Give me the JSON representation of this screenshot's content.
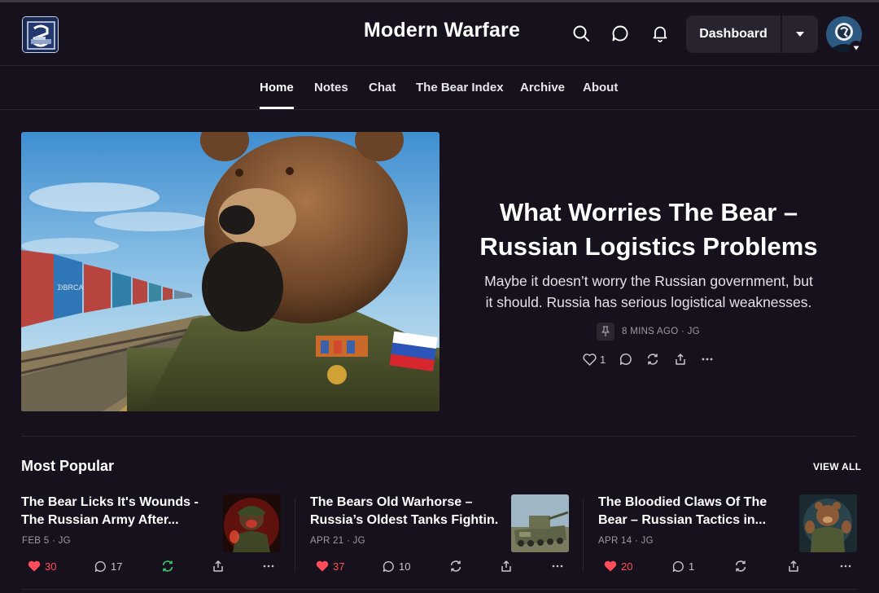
{
  "header": {
    "site_title": "Modern Warfare",
    "dashboard_label": "Dashboard",
    "icons": [
      "search-icon",
      "chat-bubble-icon",
      "bell-icon",
      "caret-down-icon"
    ]
  },
  "nav": {
    "items": [
      {
        "label": "Home",
        "active": true
      },
      {
        "label": "Notes"
      },
      {
        "label": "Chat"
      },
      {
        "label": "The Bear Index"
      },
      {
        "label": "Archive"
      },
      {
        "label": "About"
      }
    ]
  },
  "hero": {
    "title_line1": "What Worries The Bear –",
    "title_line2": "Russian Logistics Problems",
    "subtitle_line1": "Maybe it doesn’t worry the Russian government, but",
    "subtitle_line2": "it should. Russia has serious logistical weaknesses.",
    "meta": "8 MINS AGO · JG",
    "likes": "1"
  },
  "popular": {
    "title": "Most Popular",
    "view_all": "VIEW ALL",
    "cards": [
      {
        "title_line1": "The Bear Licks It's Wounds -",
        "title_line2": "The Russian Army After...",
        "meta": "FEB 5 · JG",
        "likes": "30",
        "comments": "17"
      },
      {
        "title_line1": "The Bears Old Warhorse –",
        "title_line2": "Russia’s Oldest Tanks Fightin...",
        "meta": "APR 21 · JG",
        "likes": "37",
        "comments": "10"
      },
      {
        "title_line1": "The Bloodied Claws Of The",
        "title_line2": "Bear – Russian Tactics in...",
        "meta": "APR 14 · JG",
        "likes": "20",
        "comments": "1"
      }
    ]
  },
  "colors": {
    "background": "#16111c",
    "like_red": "#ff4d5a",
    "restack_green": "#3ec76b",
    "meta_gray": "#a09aa6"
  }
}
